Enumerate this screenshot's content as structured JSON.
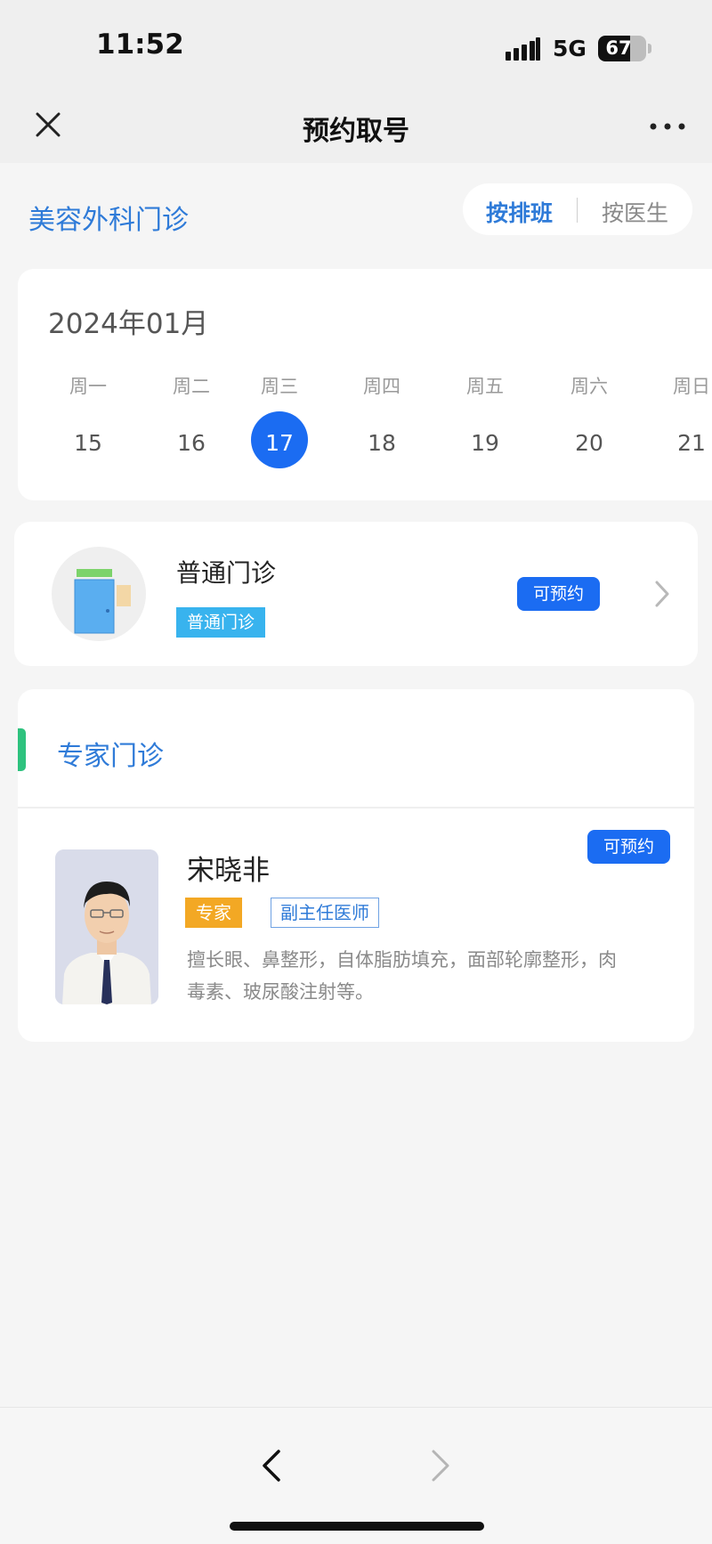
{
  "status_bar": {
    "time": "11:52",
    "network": "5G",
    "battery": "67",
    "battery_level": 0.67
  },
  "nav": {
    "title": "预约取号",
    "close_icon": "close-icon",
    "more_icon": "more-icon"
  },
  "department": {
    "name": "美容外科门诊"
  },
  "view_toggle": {
    "by_schedule": "按排班",
    "by_doctor": "按医生",
    "active": "by_schedule"
  },
  "calendar": {
    "month": "2024年01月",
    "weekdays": [
      "周一",
      "周二",
      "周三",
      "周四",
      "周五",
      "周六",
      "周日"
    ],
    "days": [
      "15",
      "16",
      "17",
      "18",
      "19",
      "20",
      "21"
    ],
    "selected_day": "17"
  },
  "general_clinic": {
    "title": "普通门诊",
    "tag": "普通门诊",
    "status": "可预约",
    "icon": "clinic-door-icon"
  },
  "expert_clinic": {
    "title": "专家门诊",
    "doctor": {
      "name": "宋晓非",
      "level_tag": "专家",
      "title_tag": "副主任医师",
      "description": "擅长眼、鼻整形，自体脂肪填充，面部轮廓整形，肉毒素、玻尿酸注射等。",
      "status": "可预约"
    }
  },
  "bottom_nav": {
    "back_icon": "chevron-left-icon",
    "forward_icon": "chevron-right-icon"
  },
  "colors": {
    "accent": "#1b6cf2",
    "link": "#2f7bd8",
    "green_bar": "#2ec27e",
    "expert_tag": "#f3a824",
    "general_tag": "#38b3ee"
  }
}
